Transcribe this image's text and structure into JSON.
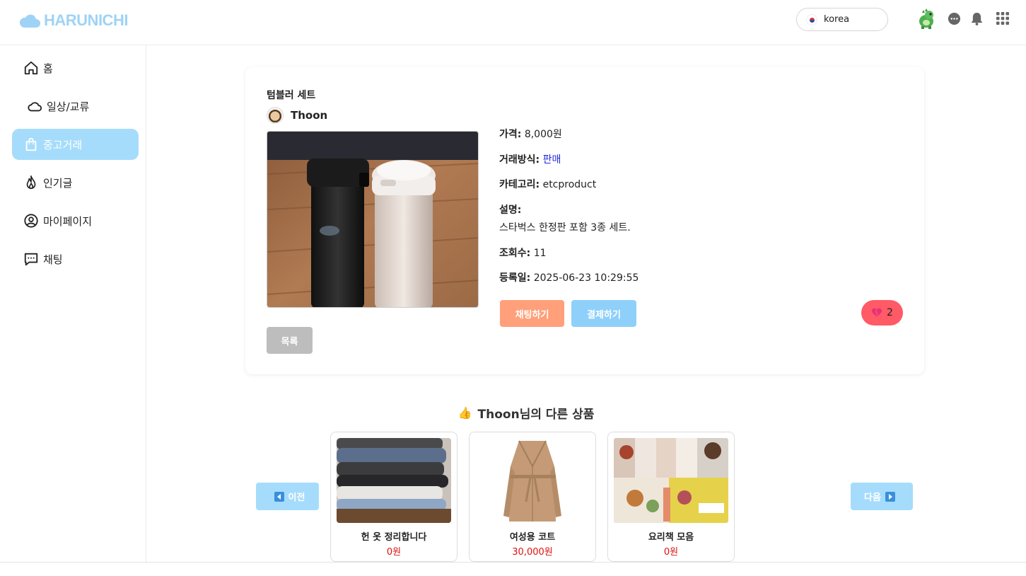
{
  "header": {
    "logo_text": "HARUNICHI",
    "language": "korea",
    "brand_color": "#9fd3f5"
  },
  "sidebar": {
    "items": [
      {
        "label": "홈",
        "icon": "home-icon"
      },
      {
        "label": "일상/교류",
        "icon": "cloud-icon"
      },
      {
        "label": "중고거래",
        "icon": "shopping-bag-icon",
        "active": true
      },
      {
        "label": "인기글",
        "icon": "fire-icon"
      },
      {
        "label": "마이페이지",
        "icon": "user-circle-icon"
      },
      {
        "label": "채팅",
        "icon": "chat-bubble-icon"
      }
    ],
    "active_color": "#a6dcfb"
  },
  "product": {
    "title": "텀블러 세트",
    "seller": "Thoon",
    "price_label": "가격:",
    "price": "8,000원",
    "trade_label": "거래방식:",
    "trade_type": "판매",
    "category_label": "카테고리:",
    "category": "etcproduct",
    "desc_label": "설명:",
    "description": "스타벅스 한정판 포함 3종 세트.",
    "views_label": "조회수:",
    "views": "11",
    "date_label": "등록일:",
    "registered": "2025-06-23 10:29:55",
    "chat_button": "채팅하기",
    "pay_button": "결제하기",
    "likes": "2",
    "list_button": "목록"
  },
  "other_products": {
    "title": "Thoon님의 다른 상품",
    "prev_label": "이전",
    "next_label": "다음",
    "items": [
      {
        "name": "헌 옷 정리합니다",
        "price": "0원"
      },
      {
        "name": "여성용 코트",
        "price": "30,000원"
      },
      {
        "name": "요리책 모음",
        "price": "0원"
      }
    ]
  }
}
